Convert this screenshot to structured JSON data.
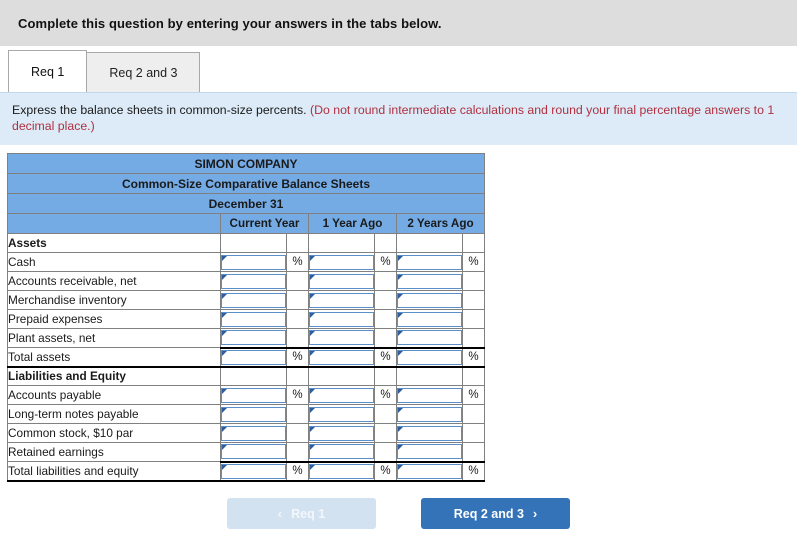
{
  "banner": {
    "text": "Complete this question by entering your answers in the tabs below."
  },
  "tabs": [
    {
      "label": "Req 1",
      "active": true
    },
    {
      "label": "Req 2 and 3",
      "active": false
    }
  ],
  "instruction": {
    "main": "Express the balance sheets in common-size percents. ",
    "hint": "(Do not round intermediate calculations and round your final percentage answers to 1 decimal place.)"
  },
  "table": {
    "title_line1": "SIMON COMPANY",
    "title_line2": "Common-Size Comparative Balance Sheets",
    "title_line3": "December 31",
    "columns": [
      "Current Year",
      "1 Year Ago",
      "2 Years Ago"
    ],
    "percent_symbol": "%",
    "rows": [
      {
        "label": "Assets",
        "type": "section",
        "inputs": false,
        "percent": false
      },
      {
        "label": "Cash",
        "type": "item",
        "inputs": true,
        "percent": true
      },
      {
        "label": "Accounts receivable, net",
        "type": "item",
        "inputs": true,
        "percent": false
      },
      {
        "label": "Merchandise inventory",
        "type": "item",
        "inputs": true,
        "percent": false
      },
      {
        "label": "Prepaid expenses",
        "type": "item",
        "inputs": true,
        "percent": false
      },
      {
        "label": "Plant assets, net",
        "type": "item",
        "inputs": true,
        "percent": false
      },
      {
        "label": "Total assets",
        "type": "total",
        "inputs": true,
        "percent": true
      },
      {
        "label": "Liabilities and Equity",
        "type": "section",
        "inputs": false,
        "percent": false
      },
      {
        "label": "Accounts payable",
        "type": "item",
        "inputs": true,
        "percent": true
      },
      {
        "label": "Long-term notes payable",
        "type": "item",
        "inputs": true,
        "percent": false
      },
      {
        "label": "Common stock, $10 par",
        "type": "item",
        "inputs": true,
        "percent": false
      },
      {
        "label": "Retained earnings",
        "type": "item",
        "inputs": true,
        "percent": false
      },
      {
        "label": "Total liabilities and equity",
        "type": "total",
        "inputs": true,
        "percent": true
      }
    ]
  },
  "nav": {
    "prev_label": "Req 1",
    "prev_icon": "chevron-left-icon",
    "prev_glyph": "‹",
    "next_label": "Req 2 and 3",
    "next_icon": "chevron-right-icon",
    "next_glyph": "›"
  },
  "colors": {
    "banner_bg": "#dddddd",
    "instruction_bg": "#dcebf7",
    "hint_text": "#b03040",
    "table_header_blue": "#74abe5",
    "primary_button": "#3573b9",
    "disabled_button": "#d3e2f0",
    "input_border": "#5b8fc9",
    "input_marker": "#2f5e9e"
  }
}
